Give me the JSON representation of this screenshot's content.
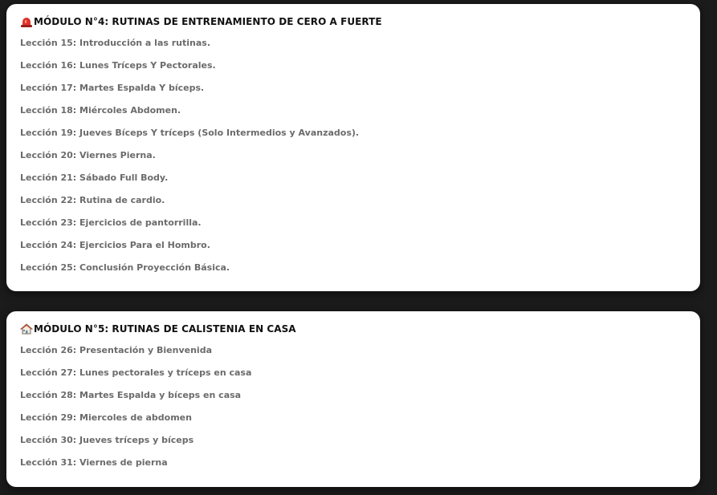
{
  "modules": [
    {
      "icon": "siren-icon",
      "title": "MÓDULO N°4: RUTINAS DE ENTRENAMIENTO DE CERO A FUERTE",
      "lessons": [
        "Lección 15: Introducción a las rutinas.",
        "Lección 16: Lunes Tríceps Y Pectorales.",
        "Lección 17: Martes Espalda Y bíceps.",
        "Lección 18: Miércoles Abdomen.",
        "Lección 19: Jueves Bíceps Y tríceps (Solo Intermedios y Avanzados).",
        "Lección 20: Viernes Pierna.",
        "Lección 21: Sábado Full Body.",
        "Lección 22: Rutina de cardio.",
        "Lección 23: Ejercicios de pantorrilla.",
        "Lección 24: Ejercicios Para el Hombro.",
        "Lección 25: Conclusión Proyección Básica."
      ]
    },
    {
      "icon": "house-icon",
      "title": "MÓDULO N°5: RUTINAS DE CALISTENIA EN CASA",
      "lessons": [
        "Lección 26: Presentación y Bienvenida",
        "Lección 27: Lunes pectorales y tríceps en casa",
        "Lección 28: Martes Espalda y bíceps en casa",
        "Lección 29: Miercoles de abdomen",
        "Lección 30: Jueves tríceps y bíceps",
        "Lección 31: Viernes de pierna"
      ]
    }
  ],
  "colors": {
    "background": "#1b1b1b",
    "card": "#ffffff",
    "title": "#111111",
    "lesson": "#6b6b6b",
    "siren_red": "#e0332b"
  }
}
